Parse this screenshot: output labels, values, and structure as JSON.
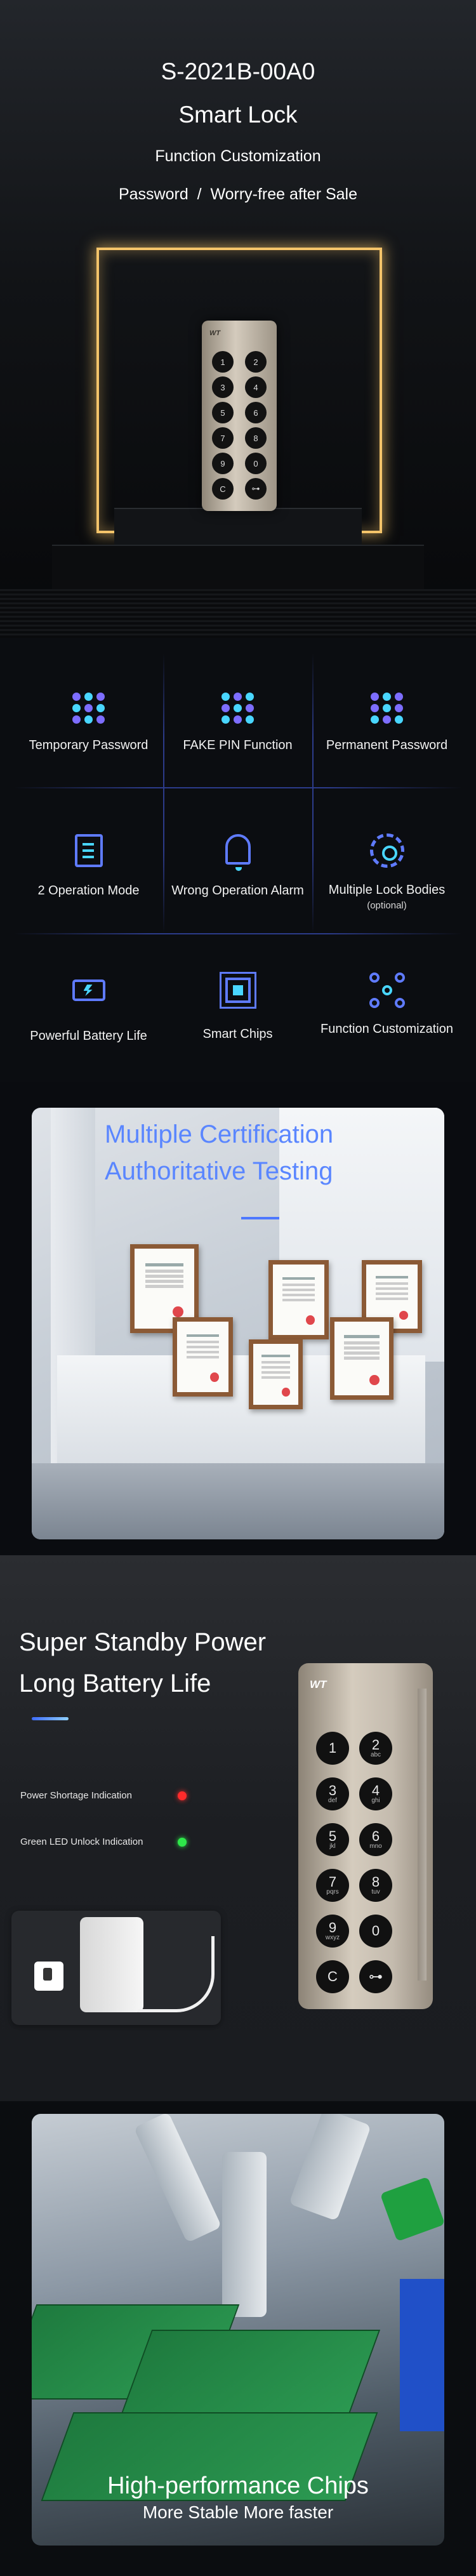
{
  "hero": {
    "model": "S-2021B-00A0",
    "product": "Smart Lock",
    "tagline": "Function Customization",
    "subtitle": "Password  /  Worry-free after Sale",
    "lock_brand": "WT"
  },
  "features": [
    {
      "label": "Temporary Password",
      "icon": "dots-grid-icon"
    },
    {
      "label": "FAKE PIN Function",
      "icon": "dots-grid-icon"
    },
    {
      "label": "Permanent Password",
      "icon": "dots-grid-icon"
    },
    {
      "label": "2 Operation Mode",
      "icon": "document-icon"
    },
    {
      "label": "Wrong Operation Alarm",
      "icon": "bell-icon"
    },
    {
      "label": "Multiple Lock Bodies",
      "sub": "(optional)",
      "icon": "gear-icon"
    },
    {
      "label": "Powerful Battery Life",
      "icon": "battery-charge-icon"
    },
    {
      "label": "Smart Chips",
      "icon": "chip-icon"
    },
    {
      "label": "Function Customization",
      "icon": "network-icon"
    }
  ],
  "certification": {
    "line1": "Multiple Certification",
    "line2": "Authoritative Testing"
  },
  "battery": {
    "line1": "Super Standby Power",
    "line2": "Long Battery Life",
    "indicator_red": "Power Shortage Indication",
    "indicator_green": "Green LED Unlock Indication",
    "brand": "WT",
    "keys": [
      {
        "d": "1",
        "l": ""
      },
      {
        "d": "2",
        "l": "abc"
      },
      {
        "d": "3",
        "l": "def"
      },
      {
        "d": "4",
        "l": "ghi"
      },
      {
        "d": "5",
        "l": "jkl"
      },
      {
        "d": "6",
        "l": "mno"
      },
      {
        "d": "7",
        "l": "pqrs"
      },
      {
        "d": "8",
        "l": "tuv"
      },
      {
        "d": "9",
        "l": "wxyz"
      },
      {
        "d": "0",
        "l": ""
      },
      {
        "d": "C",
        "l": ""
      },
      {
        "d": "⊶",
        "l": ""
      }
    ]
  },
  "chips": {
    "line1": "High-performance Chips",
    "line2": "More Stable More faster"
  },
  "colors": {
    "accent_blue": "#5f7bff",
    "accent_cyan": "#49d6ff",
    "gold_frame": "#f4c46a",
    "indicator_red": "#ff2b2b",
    "indicator_green": "#2ee84a"
  }
}
